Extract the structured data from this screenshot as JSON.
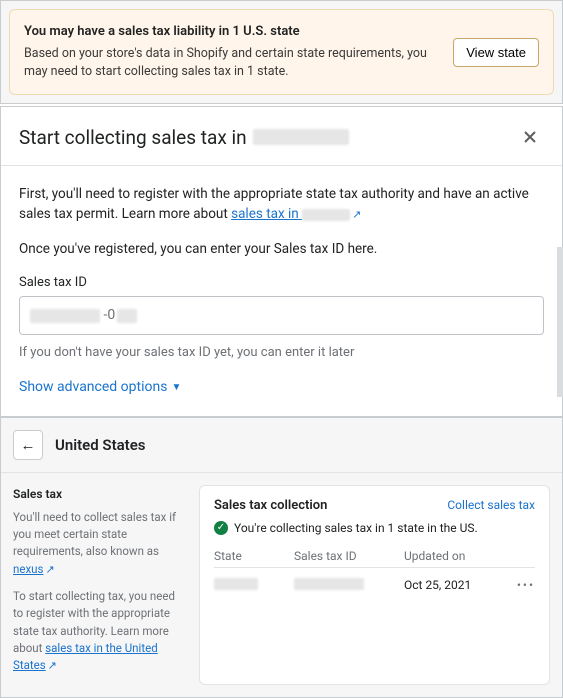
{
  "alert": {
    "title": "You may have a sales tax liability in 1 U.S. state",
    "body": "Based on your store's data in Shopify and certain state requirements, you may need to start collecting sales tax in 1 state.",
    "button": "View state"
  },
  "modal": {
    "title_prefix": "Start collecting sales tax in",
    "p1_a": "First, you'll need to register with the appropriate state tax authority and have an active sales tax permit. Learn more about ",
    "p1_link": "sales tax in",
    "p2": "Once you've registered, you can enter your Sales tax ID here.",
    "field_label": "Sales tax ID",
    "hint": "If you don't have your sales tax ID yet, you can enter it later",
    "advanced": "Show advanced options"
  },
  "settings": {
    "country": "United States",
    "heading": "Sales tax",
    "left_p1": "You'll need to collect sales tax if you meet certain state requirements, also known as ",
    "left_link1": "nexus",
    "left_p2": "To start collecting tax, you need to register with the appropriate state tax authority. Learn more about ",
    "left_link2": "sales tax in the United States",
    "card_title": "Sales tax collection",
    "collect_link": "Collect sales tax",
    "status": "You're collecting sales tax in 1 state in the US.",
    "col_state": "State",
    "col_taxid": "Sales tax ID",
    "col_updated": "Updated on",
    "row_updated": "Oct 25, 2021",
    "more": "•••"
  }
}
